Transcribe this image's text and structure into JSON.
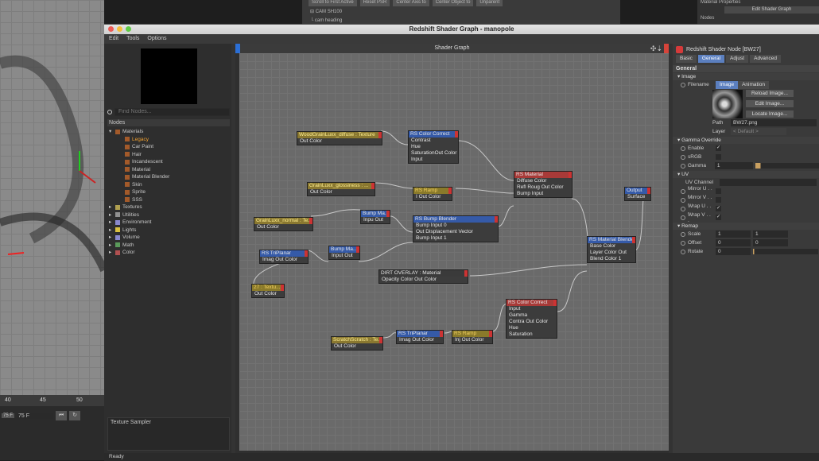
{
  "background": {
    "timeline_ticks": [
      "40",
      "45",
      "50"
    ],
    "frame_value": "75 F",
    "frame_small": "75 F",
    "top_buttons": [
      "Scroll to First Active",
      "Reset PSR",
      "Center Axis to",
      "Center Object to",
      "Unparent"
    ],
    "tree_items": [
      "CAM SH100",
      "cam heading"
    ],
    "right_title": "Material Properties",
    "right_button": "Edit Shader Graph",
    "right_nodes": "Nodes"
  },
  "window": {
    "title": "Redshift Shader Graph - manopole",
    "menu": [
      "Edit",
      "Tools",
      "Options"
    ],
    "status": "Ready",
    "colors": {
      "close": "#ee5b55",
      "min": "#f5be3a",
      "max": "#5fcb45"
    }
  },
  "left": {
    "find_placeholder": "Find Nodes...",
    "nodes_header": "Nodes",
    "tree": [
      {
        "label": "Materials",
        "color": "#a35a2a",
        "level": 0,
        "active": false
      },
      {
        "label": "Legacy",
        "color": "#a35a2a",
        "level": 1,
        "active": true
      },
      {
        "label": "Car Paint",
        "color": "#a35a2a",
        "level": 1,
        "active": false
      },
      {
        "label": "Hair",
        "color": "#a35a2a",
        "level": 1,
        "active": false
      },
      {
        "label": "Incandescent",
        "color": "#a35a2a",
        "level": 1,
        "active": false
      },
      {
        "label": "Material",
        "color": "#a35a2a",
        "level": 1,
        "active": false
      },
      {
        "label": "Material Blender",
        "color": "#a35a2a",
        "level": 1,
        "active": false
      },
      {
        "label": "Skin",
        "color": "#a35a2a",
        "level": 1,
        "active": false
      },
      {
        "label": "Sprite",
        "color": "#a35a2a",
        "level": 1,
        "active": false
      },
      {
        "label": "SSS",
        "color": "#a35a2a",
        "level": 1,
        "active": false
      },
      {
        "label": "Textures",
        "color": "#b0a050",
        "level": 0,
        "active": false
      },
      {
        "label": "Utilities",
        "color": "#909090",
        "level": 0,
        "active": false
      },
      {
        "label": "Environment",
        "color": "#8888cc",
        "level": 0,
        "active": false
      },
      {
        "label": "Lights",
        "color": "#d8c040",
        "level": 0,
        "active": false
      },
      {
        "label": "Volume",
        "color": "#8888cc",
        "level": 0,
        "active": false
      },
      {
        "label": "Math",
        "color": "#5a9a5a",
        "level": 0,
        "active": false
      },
      {
        "label": "Color",
        "color": "#b05050",
        "level": 0,
        "active": false
      }
    ],
    "sampler_label": "Texture Sampler"
  },
  "graph": {
    "header": "Shader Graph",
    "arrows": "✣⇣",
    "nodes": [
      {
        "id": "wood",
        "title": "WoodGrainLuxx_diffuse : Texture",
        "style": "gold",
        "rows": [
          "Out Color"
        ]
      },
      {
        "id": "cc1",
        "title": "RS Color Correct",
        "style": "blue",
        "rows": [
          "Contrast",
          "Hue",
          "Saturation",
          "Input"
        ],
        "out": "Out Color"
      },
      {
        "id": "rsmat",
        "title": "RS Material",
        "style": "red",
        "rows": [
          "Diffuse Color",
          "Refl Roug Out Color",
          "Bump Input"
        ]
      },
      {
        "id": "gloss",
        "title": "GrainLuxx_glossiness : ...",
        "style": "gold",
        "rows": [
          "Out Color"
        ]
      },
      {
        "id": "ramp1",
        "title": "RS Ramp",
        "style": "gold2",
        "rows": [
          "I Out Color"
        ]
      },
      {
        "id": "normal",
        "title": "GrainLuxx_normal : Te...",
        "style": "gold",
        "rows": [
          "Out Color"
        ]
      },
      {
        "id": "bump1",
        "title": "Bump Ma...",
        "style": "blue",
        "rows": [
          "Inpu Out"
        ]
      },
      {
        "id": "bumpblend",
        "title": "RS Bump Blender",
        "style": "blue",
        "rows": [
          "Bump Input 0",
          "Out Displacement Vector",
          "Bump Input 1"
        ]
      },
      {
        "id": "output",
        "title": "Output",
        "style": "blue",
        "rows": [
          "Surface"
        ]
      },
      {
        "id": "tri1",
        "title": "RS TriPlanar",
        "style": "blue",
        "rows": [
          "Imag Out Color"
        ]
      },
      {
        "id": "bump2",
        "title": "Bump Ma...",
        "style": "blue",
        "rows": [
          "Input Out"
        ]
      },
      {
        "id": "matblend",
        "title": "RS Material Blender",
        "style": "blue",
        "rows": [
          "Base Color",
          "Layer Color Out",
          "Blend Color 1"
        ]
      },
      {
        "id": "tex27",
        "title": "27 : Textu...",
        "style": "gold2",
        "rows": [
          "Out Color"
        ]
      },
      {
        "id": "dirt",
        "title": "DIRT OVERLAY : Material",
        "style": "grey",
        "rows": [
          "Opacity Color Out Color"
        ]
      },
      {
        "id": "cc2",
        "title": "RS Color Correct",
        "style": "red",
        "rows": [
          "Input",
          "Gamma",
          "Contra Out Color",
          "Hue",
          "Saturation"
        ]
      },
      {
        "id": "scratch",
        "title": "ScratchScratch : Te...",
        "style": "gold",
        "rows": [
          "Out Color"
        ]
      },
      {
        "id": "tri2",
        "title": "RS TriPlanar",
        "style": "blue",
        "rows": [
          "Imag Out Color"
        ]
      },
      {
        "id": "ramp2",
        "title": "RS Ramp",
        "style": "gold2",
        "rows": [
          "Inj Out Color"
        ]
      }
    ]
  },
  "right": {
    "title": "Redshift Shader Node [BW27]",
    "tabs": [
      "Basic",
      "General",
      "Adjust",
      "Advanced"
    ],
    "active_tab": "General",
    "general": "General",
    "image": "Image",
    "filename": "Filename",
    "img_tabs": [
      "Image",
      "Animation"
    ],
    "reload": "Reload Image...",
    "edit": "Edit Image...",
    "locate": "Locate Image...",
    "path_label": "Path",
    "path": "BW27.png",
    "layer_label": "Layer",
    "layer": "< Default >",
    "gamma_override": "Gamma Override",
    "enable": "Enable",
    "srgb": "sRGB",
    "gamma": "Gamma",
    "gamma_val": "1",
    "uv": "UV",
    "uv_channel": "UV Channel",
    "mirror_u": "Mirror U . . .",
    "mirror_v": "Mirror V . . .",
    "wrap_u": "Wrap U . . .",
    "wrap_v": "Wrap V . . .",
    "remap": "Remap",
    "scale": "Scale",
    "scale_u": "1",
    "scale_v": "1",
    "offset": "Offset",
    "offset_u": "0",
    "offset_v": "0",
    "rotate": "Rotate",
    "rotate_val": "0",
    "check": "✓"
  }
}
